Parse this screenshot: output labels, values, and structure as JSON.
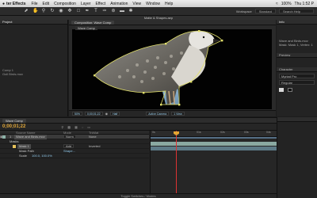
{
  "menubar": {
    "app": "ter Effects",
    "items": [
      "File",
      "Edit",
      "Composition",
      "Layer",
      "Effect",
      "Animation",
      "View",
      "Window",
      "Help"
    ],
    "clock": "Thu 1:52 P",
    "battery": "100%"
  },
  "toolbar": {
    "workspace_label": "Workspace",
    "workspace_value": "Standard",
    "search_placeholder": "Search Help"
  },
  "document_title": "Matte & Shapes.aep",
  "project_panel": {
    "tab_label": "Project",
    "comp_label": "Comp 1",
    "item_label": "Gull Birds.mov"
  },
  "viewer": {
    "tab_label": "Composition: Wave Comp",
    "comp_name": "Wave Comp",
    "zoom": "50%",
    "timecode": "0;00;01;22",
    "resolution": "Half",
    "camera": "Active Camera",
    "view": "1 View"
  },
  "right_panel": {
    "header": "Info",
    "lines": [
      "Wave and Birds.mov",
      "Mask: Mask 1, Vertex: 1"
    ],
    "preview_label": "Preview",
    "character_label": "Character",
    "font_value": "Myriad Pro",
    "style_value": "Regular"
  },
  "timeline": {
    "tab_label": "Wave Comp",
    "timecode": "0;00;01;22",
    "columns": [
      "Source Name",
      "Mode",
      "TrkMat"
    ],
    "layers": [
      {
        "num": "1",
        "name": "Wave and Birds.mov",
        "mode": "Norm",
        "trkmat": "None",
        "chip": "#8db3a8",
        "selected": true
      },
      {
        "num": "",
        "name": "Masks",
        "mode": "",
        "trkmat": "",
        "chip": "",
        "selected": false
      },
      {
        "num": "",
        "name": "Mask 1",
        "mode": "Add",
        "trkmat": "Inverted",
        "chip": "#e5c15a",
        "selected": false
      },
      {
        "num": "",
        "name": "Mask Path",
        "mode": "Shape...",
        "trkmat": "",
        "chip": "",
        "selected": false
      },
      {
        "num": "",
        "name": "Scale",
        "mode": "",
        "trkmat": "",
        "value": "100.0, 100.0%",
        "chip": "",
        "selected": false
      }
    ],
    "ruler_ticks": [
      "0s",
      "01s",
      "02s",
      "03s",
      "04s"
    ],
    "footer": "Toggle Switches / Modes"
  },
  "colors": {
    "timecode": "#e3a93a",
    "playhead": "#dd3333",
    "mask_outline": "#e2e06a",
    "layer_bar": "#8aa9a2"
  }
}
